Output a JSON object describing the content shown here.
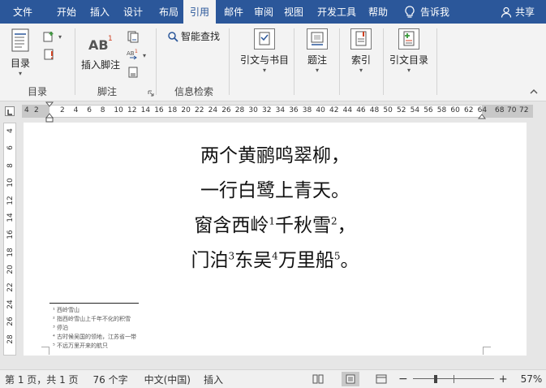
{
  "tabs": [
    {
      "label": "文件",
      "active": false
    },
    {
      "label": "开始",
      "active": false
    },
    {
      "label": "插入",
      "active": false
    },
    {
      "label": "设计",
      "active": false
    },
    {
      "label": "布局",
      "active": false
    },
    {
      "label": "引用",
      "active": true
    },
    {
      "label": "邮件",
      "active": false
    },
    {
      "label": "审阅",
      "active": false
    },
    {
      "label": "视图",
      "active": false
    },
    {
      "label": "开发工具",
      "active": false
    },
    {
      "label": "帮助",
      "active": false
    }
  ],
  "tell_me": {
    "icon": "lightbulb-icon",
    "label": "告诉我"
  },
  "share": {
    "icon": "person-icon",
    "label": "共享"
  },
  "ribbon": {
    "toc": {
      "button": "目录",
      "group": "目录"
    },
    "footnotes": {
      "button": "插入脚注",
      "group": "脚注"
    },
    "research": {
      "smart_lookup": "智能查找",
      "group": "信息检索"
    },
    "citations": {
      "button": "引文与书目"
    },
    "captions": {
      "button": "题注"
    },
    "index": {
      "button": "索引"
    },
    "toa": {
      "button": "引文目录"
    }
  },
  "ruler": {
    "left_numbers": [
      "4",
      "2"
    ],
    "numbers": [
      "2",
      "4",
      "6",
      "8",
      "10",
      "12",
      "14",
      "16",
      "18",
      "20",
      "22",
      "24",
      "26",
      "28",
      "30",
      "32",
      "34",
      "36",
      "38",
      "40",
      "42",
      "44",
      "46",
      "48",
      "50",
      "52",
      "54",
      "56",
      "58",
      "60",
      "62",
      "64"
    ],
    "right_numbers": [
      "68",
      "70",
      "72"
    ]
  },
  "vruler_numbers": [
    "4",
    "6",
    "8",
    "10",
    "12",
    "14",
    "16",
    "18",
    "20",
    "22",
    "24",
    "26",
    "28"
  ],
  "poem": {
    "line1": "两个黄鹂鸣翠柳，",
    "line2": "一行白鹭上青天。",
    "line3_a": "窗含西岭",
    "line3_sup1": "1",
    "line3_b": "千秋雪",
    "line3_sup2": "2",
    "line3_c": "，",
    "line4_a": "门泊",
    "line4_sup1": "3",
    "line4_b": "东吴",
    "line4_sup2": "4",
    "line4_c": "万里船",
    "line4_sup3": "5",
    "line4_d": "。"
  },
  "footnotes": [
    "¹ 西岭雪山",
    "² 指西岭雪山上千年不化的积雪",
    "³ 停泊",
    "⁴ 古时候吴国的领地，江苏省一带",
    "⁵ 不远万里开来的航只"
  ],
  "status": {
    "page": "第 1 页，共 1 页",
    "words": "76 个字",
    "language": "中文(中国)",
    "mode": "插入",
    "zoom": "57%",
    "zoom_minus": "−",
    "zoom_plus": "+"
  },
  "colors": {
    "accent": "#2b579a",
    "ribbon_bg": "#f3f3f3"
  }
}
